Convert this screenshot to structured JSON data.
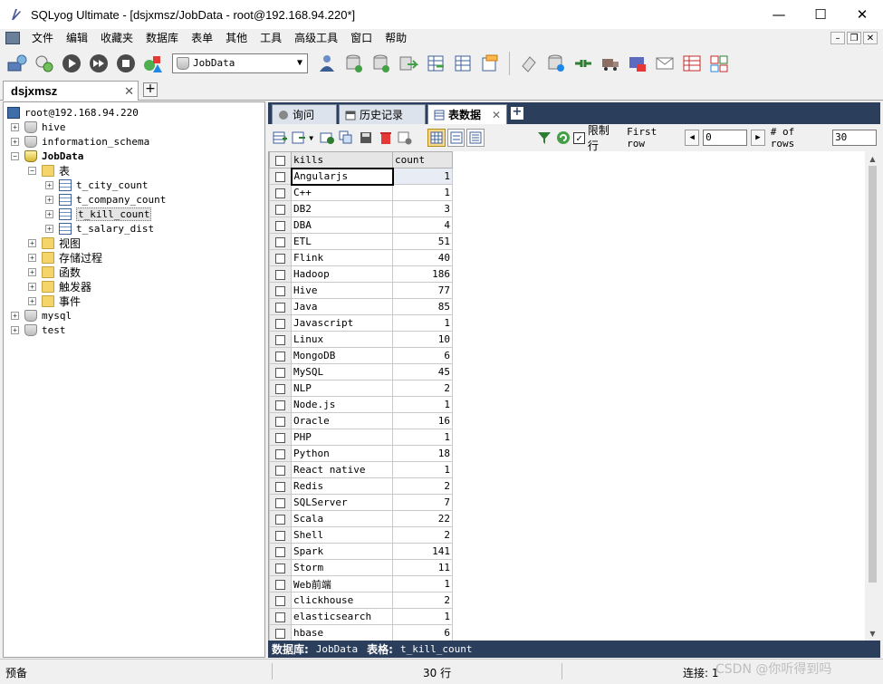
{
  "window": {
    "title": "SQLyog Ultimate - [dsjxmsz/JobData - root@192.168.94.220*]"
  },
  "menu": [
    "文件",
    "编辑",
    "收藏夹",
    "数据库",
    "表单",
    "其他",
    "工具",
    "高级工具",
    "窗口",
    "帮助"
  ],
  "toolbar": {
    "database_selected": "JobData"
  },
  "connection_tab": {
    "label": "dsjxmsz"
  },
  "tree": {
    "server": "root@192.168.94.220",
    "databases": [
      "hive",
      "information_schema",
      "JobData",
      "mysql",
      "test"
    ],
    "tables_folder": "表",
    "tables": [
      "t_city_count",
      "t_company_count",
      "t_kill_count",
      "t_salary_dist"
    ],
    "folders": [
      "视图",
      "存储过程",
      "函数",
      "触发器",
      "事件"
    ]
  },
  "result_tabs": [
    {
      "label": "询问"
    },
    {
      "label": "历史记录"
    },
    {
      "label": "表数据"
    }
  ],
  "grid_toolbar": {
    "limit_label": "限制行",
    "first_row_label": "First row",
    "first_row_value": "0",
    "rows_label": "# of rows",
    "rows_value": "30"
  },
  "grid": {
    "columns": [
      "kills",
      "count"
    ],
    "rows": [
      [
        "Angularjs",
        "1"
      ],
      [
        "C++",
        "1"
      ],
      [
        "DB2",
        "3"
      ],
      [
        "DBA",
        "4"
      ],
      [
        "ETL",
        "51"
      ],
      [
        "Flink",
        "40"
      ],
      [
        "Hadoop",
        "186"
      ],
      [
        "Hive",
        "77"
      ],
      [
        "Java",
        "85"
      ],
      [
        "Javascript",
        "1"
      ],
      [
        "Linux",
        "10"
      ],
      [
        "MongoDB",
        "6"
      ],
      [
        "MySQL",
        "45"
      ],
      [
        "NLP",
        "2"
      ],
      [
        "Node.js",
        "1"
      ],
      [
        "Oracle",
        "16"
      ],
      [
        "PHP",
        "1"
      ],
      [
        "Python",
        "18"
      ],
      [
        "React native",
        "1"
      ],
      [
        "Redis",
        "2"
      ],
      [
        "SQLServer",
        "7"
      ],
      [
        "Scala",
        "22"
      ],
      [
        "Shell",
        "2"
      ],
      [
        "Spark",
        "141"
      ],
      [
        "Storm",
        "11"
      ],
      [
        "Web前端",
        "1"
      ],
      [
        "clickhouse",
        "2"
      ],
      [
        "elasticsearch",
        "1"
      ],
      [
        "hbase",
        "6"
      ]
    ]
  },
  "info_bar": {
    "db_label": "数据库:",
    "db_value": "JobData",
    "table_label": "表格:",
    "table_value": "t_kill_count"
  },
  "status": {
    "left": "预备",
    "rows": "30 行",
    "conn": "连接: 1"
  },
  "watermark": "CSDN @你听得到吗"
}
